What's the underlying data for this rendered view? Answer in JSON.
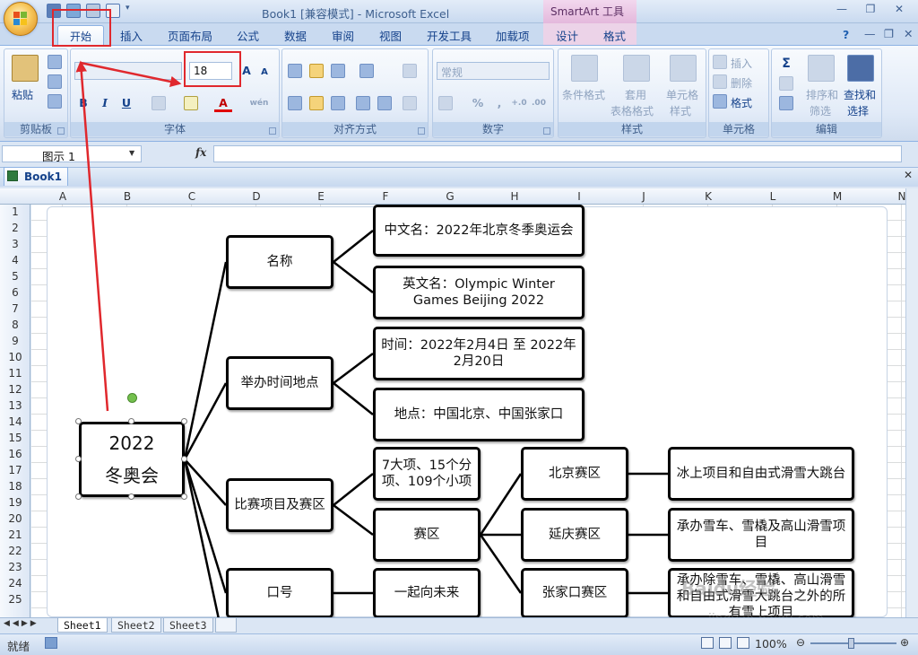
{
  "window": {
    "title": "Book1  [兼容模式] - Microsoft Excel",
    "context_tool": "SmartArt 工具"
  },
  "tabs": [
    {
      "label": "开始",
      "active": true
    },
    {
      "label": "插入"
    },
    {
      "label": "页面布局"
    },
    {
      "label": "公式"
    },
    {
      "label": "数据"
    },
    {
      "label": "审阅"
    },
    {
      "label": "视图"
    },
    {
      "label": "开发工具"
    },
    {
      "label": "加载项"
    },
    {
      "label": "设计"
    },
    {
      "label": "格式"
    }
  ],
  "ribbon": {
    "clipboard": {
      "label": "剪贴板",
      "paste": "粘贴"
    },
    "font": {
      "label": "字体",
      "font_name": "",
      "font_size": "18",
      "bold": "B",
      "italic": "I",
      "underline": "U",
      "grow": "A",
      "shrink": "A",
      "color_letter": "A",
      "wen": "wén"
    },
    "alignment": {
      "label": "对齐方式"
    },
    "number": {
      "label": "数字",
      "format": "常规",
      "percent": "%",
      "comma": ",",
      "inc": "+.0",
      "dec": ".00"
    },
    "styles": {
      "label": "样式",
      "conditional": "条件格式",
      "table_1": "套用",
      "table_2": "表格格式",
      "cell_1": "单元格",
      "cell_2": "样式"
    },
    "cells": {
      "label": "单元格",
      "insert": "插入",
      "delete": "删除",
      "format": "格式"
    },
    "editing": {
      "label": "编辑",
      "sigma": "Σ",
      "sort_1": "排序和",
      "sort_2": "筛选",
      "find_1": "查找和",
      "find_2": "选择"
    }
  },
  "formula_bar": {
    "name_box": "图示 1",
    "fx": "fx",
    "value": ""
  },
  "workbook": {
    "tab": "Book1"
  },
  "columns": [
    "A",
    "B",
    "C",
    "D",
    "E",
    "F",
    "G",
    "H",
    "I",
    "J",
    "K",
    "L",
    "M",
    "N"
  ],
  "rows": [
    "1",
    "2",
    "3",
    "4",
    "5",
    "6",
    "7",
    "8",
    "9",
    "10",
    "11",
    "12",
    "13",
    "14",
    "15",
    "16",
    "17",
    "18",
    "19",
    "20",
    "21",
    "22",
    "23",
    "24",
    "25"
  ],
  "smartart": {
    "root": {
      "line1": "2022",
      "line2": "冬奥会"
    },
    "n_name": "名称",
    "n_cn": "中文名：2022年北京冬季奥运会",
    "n_en": "英文名：Olympic Winter Games Beijing 2022",
    "n_timeplace": "举办时间地点",
    "n_time": "时间：2022年2月4日 至 2022年2月20日",
    "n_place": "地点：中国北京、中国张家口",
    "n_events": "比赛项目及赛区",
    "n_count": "7大项、15个分项、109个小项",
    "n_zones": "赛区",
    "n_beijing": "北京赛区",
    "n_beijing_d": "冰上项目和自由式滑雪大跳台",
    "n_yanqing": "延庆赛区",
    "n_yanqing_d": "承办雪车、雪橇及高山滑雪项目",
    "n_zjk": "张家口赛区",
    "n_zjk_d": "承办除雪车、雪橇、高山滑雪和自由式滑雪大跳台之外的所有雪上项目",
    "n_slogan": "口号",
    "n_slogan_v": "一起向未来"
  },
  "sheets": [
    "Sheet1",
    "Sheet2",
    "Sheet3"
  ],
  "status": {
    "text": "就绪",
    "zoom": "100%"
  },
  "watermark": {
    "main": "Baidu经验",
    "sub": "jingyan.baidu.com"
  },
  "colors": {
    "annotation": "#e0282d",
    "node_border": "#000000",
    "ribbon_text": "#15428b"
  }
}
